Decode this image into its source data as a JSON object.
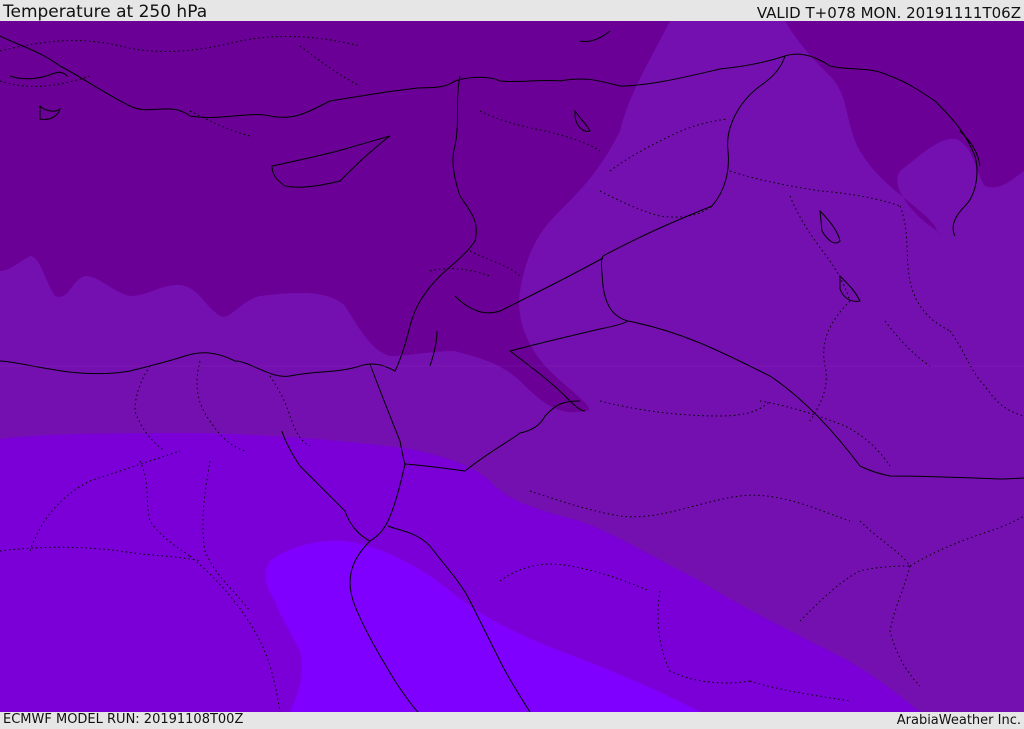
{
  "header": {
    "title": "Temperature at 250 hPa",
    "valid_time": "VALID T+078 MON. 20191111T06Z"
  },
  "footer": {
    "model_run": "ECMWF MODEL RUN: 20191108T00Z",
    "credit": "ArabiaWeather Inc."
  },
  "map": {
    "field": "temperature",
    "level": "250 hPa",
    "colors": {
      "coldest": "#6a0096",
      "cold": "#7510b0",
      "mid": "#7b00d8",
      "warmer": "#7e00f0",
      "warmest": "#8000ff",
      "boundary_line": "#000000"
    }
  }
}
